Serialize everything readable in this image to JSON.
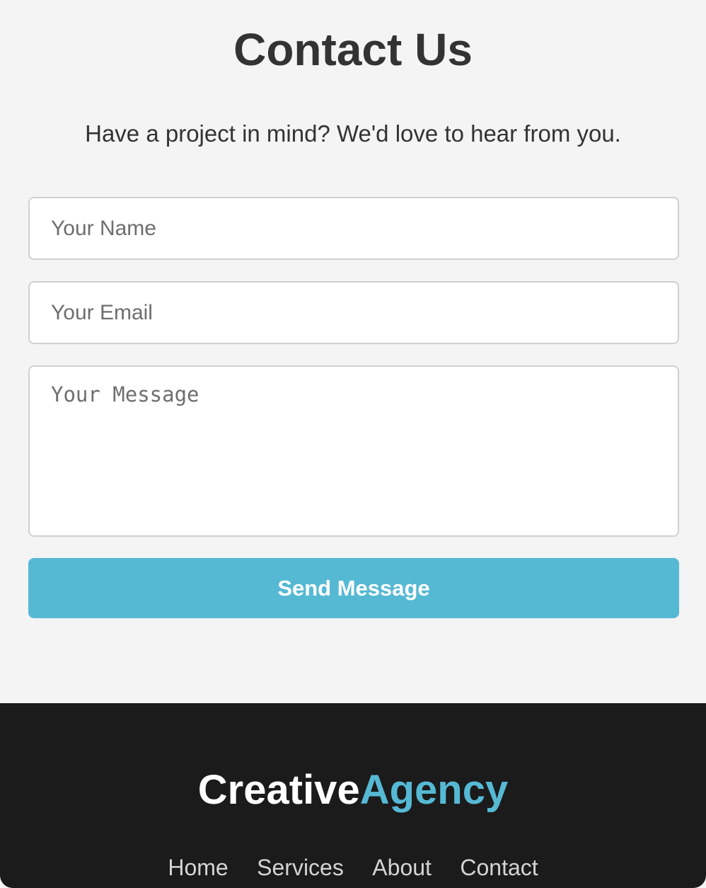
{
  "contact": {
    "title": "Contact Us",
    "subtitle": "Have a project in mind? We'd love to hear from you.",
    "name_placeholder": "Your Name",
    "email_placeholder": "Your Email",
    "message_placeholder": "Your Message",
    "submit_label": "Send Message"
  },
  "footer": {
    "logo_part_1": "Creative",
    "logo_part_2": "Agency",
    "nav": [
      {
        "label": "Home"
      },
      {
        "label": "Services"
      },
      {
        "label": "About"
      },
      {
        "label": "Contact"
      }
    ]
  },
  "colors": {
    "accent": "#56b9d4",
    "page_background": "#f4f4f4",
    "footer_background": "#1b1b1b",
    "heading_text": "#333333"
  }
}
